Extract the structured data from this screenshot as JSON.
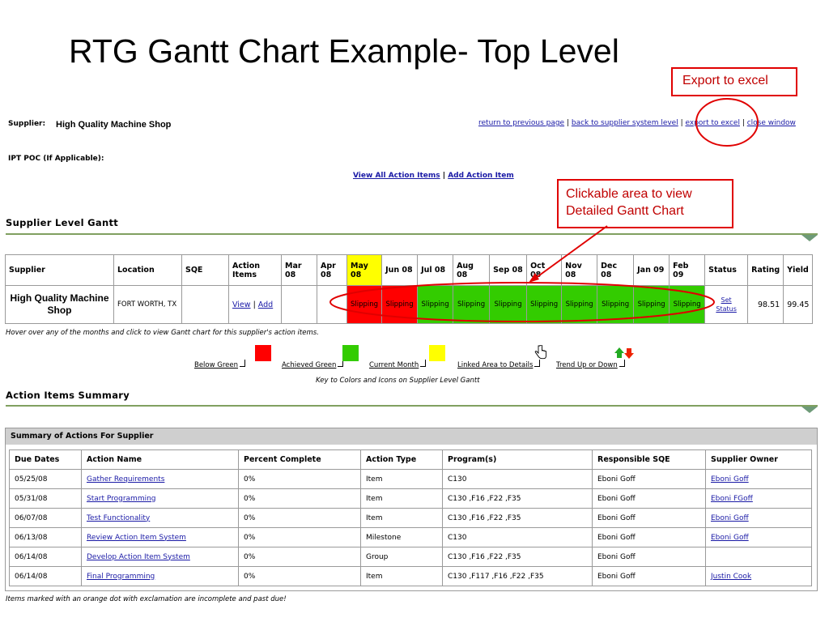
{
  "slide_title": "RTG Gantt Chart Example- Top Level",
  "callouts": {
    "export": "Export to excel",
    "gantt_line1": "Clickable area to view",
    "gantt_line2": "Detailed Gantt Chart"
  },
  "supplier": {
    "label": "Supplier:",
    "value": "High Quality Machine Shop"
  },
  "top_links": [
    "return to previous page",
    "back to supplier system level",
    "export to excel",
    "close window"
  ],
  "ipt_label": "IPT POC (If Applicable):",
  "action_links": [
    "View All Action Items",
    "Add Action Item"
  ],
  "gantt_section_title": "Supplier Level Gantt",
  "gantt": {
    "headers": [
      "Supplier",
      "Location",
      "SQE",
      "Action Items",
      "Mar 08",
      "Apr 08",
      "May 08",
      "Jun 08",
      "Jul 08",
      "Aug 08",
      "Sep 08",
      "Oct 08",
      "Nov 08",
      "Dec 08",
      "Jan 09",
      "Feb 09",
      "Status",
      "Rating",
      "Yield"
    ],
    "row": {
      "supplier": "High Quality Machine Shop",
      "location": "FORT WORTH, TX",
      "sqe": "",
      "view": "View",
      "add": "Add",
      "months": [
        "",
        "",
        "Slipping",
        "Slipping",
        "Slipping",
        "Slipping",
        "Slipping",
        "Slipping",
        "Slipping",
        "Slipping",
        "Slipping",
        "Slipping"
      ],
      "set": "Set",
      "status": "Status",
      "rating": "98.51",
      "yield": "99.45"
    }
  },
  "hover_note": "Hover over any of the months and click to view Gantt chart for this supplier's action items.",
  "legend": {
    "below_green": "Below Green",
    "achieved_green": "Achieved Green",
    "current_month": "Current Month",
    "linked_area": "Linked Area to Details",
    "trend": "Trend Up or Down",
    "key": "Key to Colors and Icons on Supplier Level Gantt",
    "colors": {
      "red": "#ff0000",
      "green": "#33cc00",
      "yellow": "#ffff00"
    }
  },
  "summary_section_title": "Action Items Summary",
  "summary": {
    "header": "Summary of Actions For Supplier",
    "columns": [
      "Due Dates",
      "Action Name",
      "Percent Complete",
      "Action Type",
      "Program(s)",
      "Responsible SQE",
      "Supplier Owner"
    ],
    "rows": [
      [
        "05/25/08",
        "Gather Requirements",
        "0%",
        "Item",
        "C130",
        "Eboni Goff",
        "Eboni Goff"
      ],
      [
        "05/31/08",
        "Start Programming",
        "0%",
        "Item",
        "C130 ,F16 ,F22 ,F35",
        "Eboni Goff",
        "Eboni FGoff"
      ],
      [
        "06/07/08",
        "Test Functionality",
        "0%",
        "Item",
        "C130 ,F16 ,F22 ,F35",
        "Eboni Goff",
        "Eboni Goff"
      ],
      [
        "06/13/08",
        "Review Action Item System",
        "0%",
        "Milestone",
        "C130",
        "Eboni Goff",
        "Eboni Goff"
      ],
      [
        "06/14/08",
        "Develop Action Item System",
        "0%",
        "Group",
        "C130 ,F16 ,F22 ,F35",
        "Eboni Goff",
        ""
      ],
      [
        "06/14/08",
        "Final Programming",
        "0%",
        "Item",
        "C130 ,F117 ,F16 ,F22 ,F35",
        "Eboni Goff",
        "Justin Cook"
      ]
    ]
  },
  "footer_note": "Items marked with an orange dot with exclamation are incomplete and past due!"
}
